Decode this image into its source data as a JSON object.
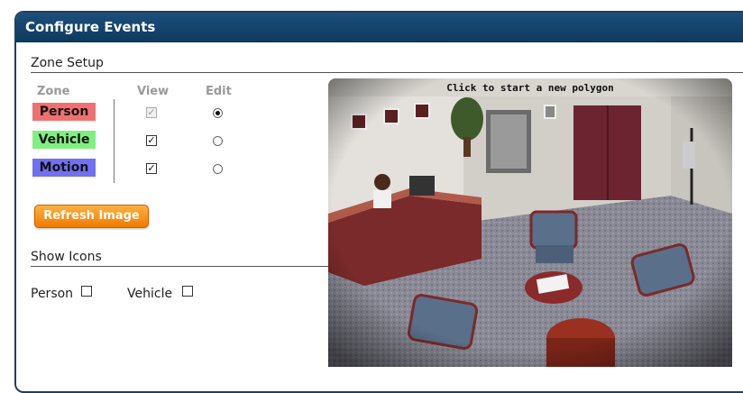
{
  "window": {
    "title": "Configure Events"
  },
  "zone_setup": {
    "label": "Zone Setup",
    "columns": {
      "zone": "Zone",
      "view": "View",
      "edit": "Edit"
    },
    "zones": [
      {
        "name": "Person",
        "color": "#f07070",
        "view_checked": true,
        "view_disabled": true,
        "edit_selected": true
      },
      {
        "name": "Vehicle",
        "color": "#7ff07f",
        "view_checked": true,
        "view_disabled": false,
        "edit_selected": false
      },
      {
        "name": "Motion",
        "color": "#7070f0",
        "view_checked": true,
        "view_disabled": false,
        "edit_selected": false
      }
    ],
    "refresh_label": "Refresh Image"
  },
  "show_icons": {
    "label": "Show Icons",
    "options": [
      {
        "label": "Person",
        "checked": false
      },
      {
        "label": "Vehicle",
        "checked": false
      }
    ]
  },
  "camera": {
    "caption": "Click to start a new polygon"
  },
  "colors": {
    "titlebar": "#0d3a5e",
    "button": "#f07a00"
  }
}
